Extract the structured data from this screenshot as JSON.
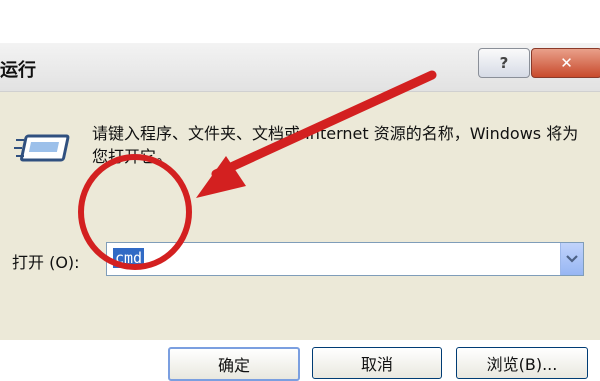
{
  "window": {
    "title": "运行",
    "help_glyph": "?",
    "close_glyph": "✕"
  },
  "dialog": {
    "description": "请键入程序、文件夹、文档或 Internet 资源的名称，Windows 将为您打开它。",
    "open_label": "打开 (O):",
    "open_value": "cmd",
    "ok_label": "确定",
    "cancel_label": "取消",
    "browse_label": "浏览(B)..."
  },
  "annotation": {
    "color": "#d32020"
  }
}
